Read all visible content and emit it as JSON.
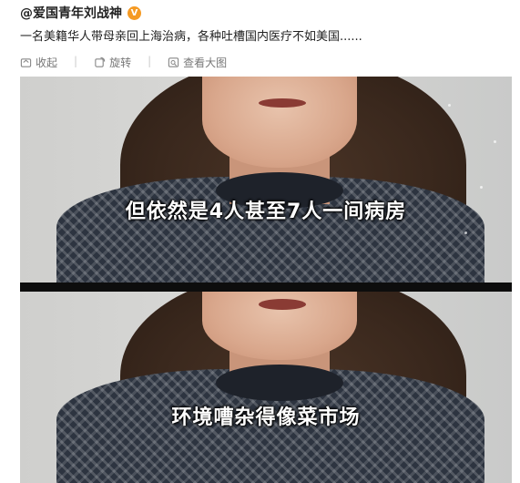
{
  "post": {
    "author": "@爱国青年刘战神",
    "verified_badge": "V",
    "text": "一名美籍华人带母亲回上海治病，各种吐槽国内医疗不如美国......"
  },
  "actions": [
    {
      "label": "收起",
      "icon": "collapse-icon"
    },
    {
      "label": "旋转",
      "icon": "rotate-icon"
    },
    {
      "label": "查看大图",
      "icon": "view-large-icon"
    }
  ],
  "image": {
    "frames": [
      {
        "subtitle": "但依然是4人甚至7人一间病房"
      },
      {
        "subtitle": "环境嘈杂得像菜市场"
      }
    ]
  }
}
